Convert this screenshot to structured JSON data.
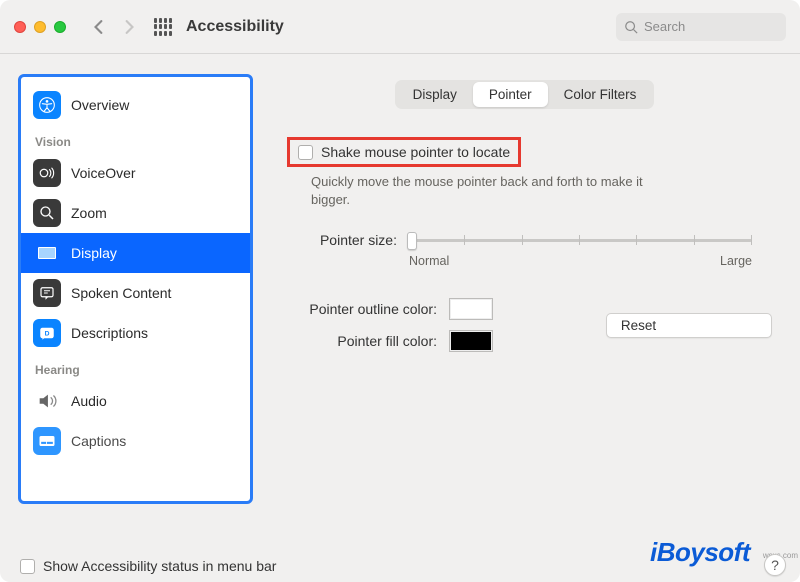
{
  "titlebar": {
    "title": "Accessibility",
    "search_placeholder": "Search"
  },
  "sidebar": {
    "overview": "Overview",
    "sections": {
      "vision": {
        "label": "Vision",
        "items": [
          "VoiceOver",
          "Zoom",
          "Display",
          "Spoken Content",
          "Descriptions"
        ]
      },
      "hearing": {
        "label": "Hearing",
        "items": [
          "Audio",
          "Captions"
        ]
      }
    }
  },
  "tabs": [
    "Display",
    "Pointer",
    "Color Filters"
  ],
  "content": {
    "shake_label": "Shake mouse pointer to locate",
    "shake_hint": "Quickly move the mouse pointer back and forth to make it bigger.",
    "pointer_size_label": "Pointer size:",
    "slider_min": "Normal",
    "slider_max": "Large",
    "outline_label": "Pointer outline color:",
    "fill_label": "Pointer fill color:",
    "reset": "Reset"
  },
  "footer": {
    "status_label": "Show Accessibility status in menu bar"
  },
  "watermark": "iBoysoft",
  "attribution": "wsxs.com"
}
